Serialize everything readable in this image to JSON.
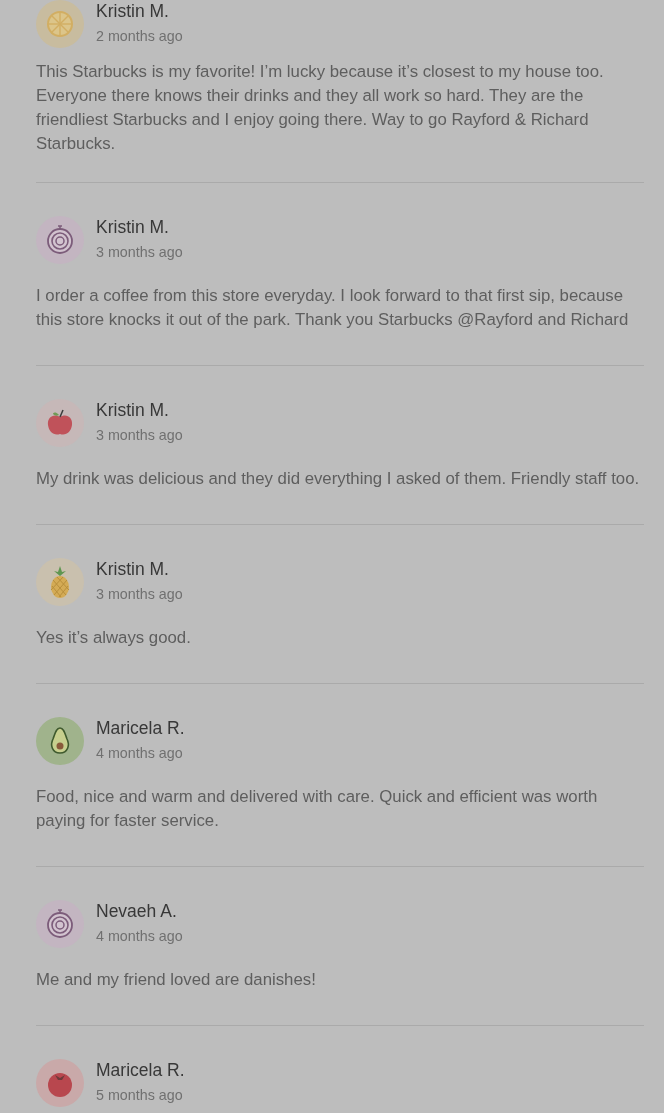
{
  "reviews": [
    {
      "kind": "citrus",
      "name": "Kristin M.",
      "time": "2 months ago",
      "text": "This Starbucks is my favorite! I’m lucky because it’s closest to my house too. Everyone there knows their drinks and they all work so hard. They are the friendliest Starbucks and I enjoy going there. Way to go Rayford & Richard Starbucks."
    },
    {
      "kind": "onion",
      "name": "Kristin M.",
      "time": "3 months ago",
      "text": "I order a coffee from this store everyday. I look forward to that first sip, because this store knocks it out of the park. Thank you Starbucks @Rayford and Richard"
    },
    {
      "kind": "apple",
      "name": "Kristin M.",
      "time": "3 months ago",
      "text": "My drink was delicious and they did everything I asked of them. Friendly staff too."
    },
    {
      "kind": "pineapple",
      "name": "Kristin M.",
      "time": "3 months ago",
      "text": "Yes it’s always good."
    },
    {
      "kind": "avocado",
      "name": "Maricela R.",
      "time": "4 months ago",
      "text": "Food, nice and warm and delivered with care. Quick and efficient was worth paying for faster service."
    },
    {
      "kind": "onion",
      "name": "Nevaeh A.",
      "time": "4 months ago",
      "text": "Me and my friend loved are danishes!"
    },
    {
      "kind": "tomato",
      "name": "Maricela R.",
      "time": "5 months ago"
    }
  ]
}
